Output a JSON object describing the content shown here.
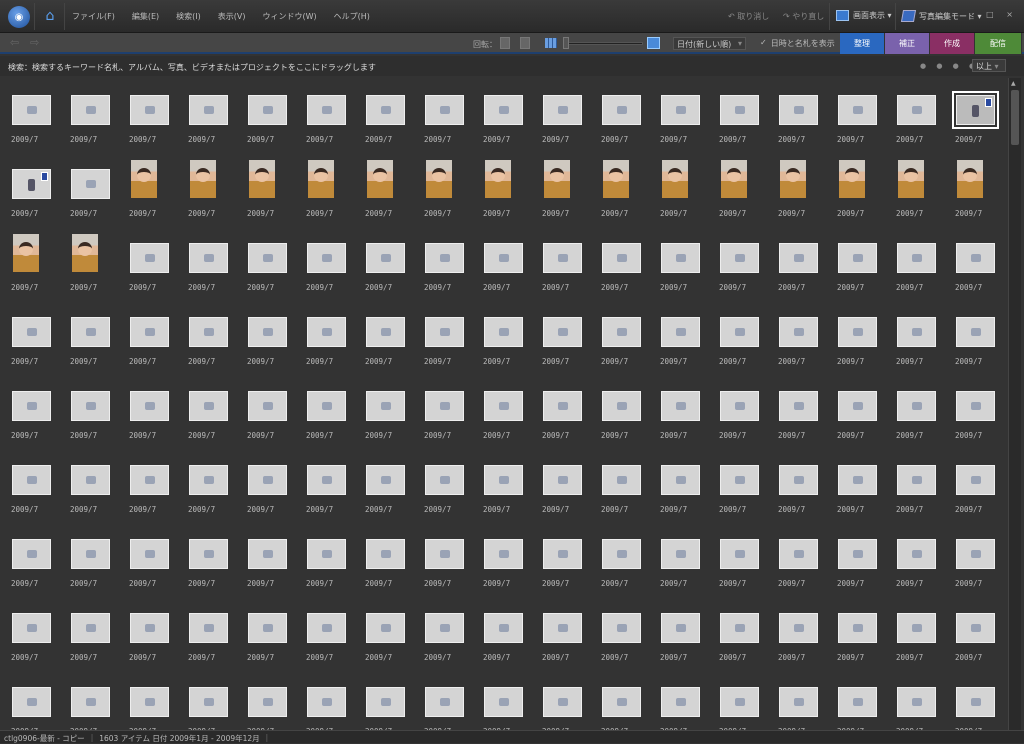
{
  "titlebar": {
    "menu": [
      "ファイル(F)",
      "編集(E)",
      "検索(I)",
      "表示(V)",
      "ウィンドウ(W)",
      "ヘルプ(H)"
    ],
    "undo": "取り消し",
    "redo": "やり直し",
    "display": "画面表示 ▾",
    "edit_mode": "写真編集モード ▾",
    "window_controls": "_ □ ×"
  },
  "toolbar": {
    "rotate_label": "回転：",
    "sort": "日付(新しい順)",
    "show_date_tags": "日時と名札を表示",
    "checkbox_checked": true,
    "tabs": [
      {
        "label": "整理",
        "color": "#2a68c0"
      },
      {
        "label": "補正",
        "color": "#7a62ac"
      },
      {
        "label": "作成",
        "color": "#8a2f64"
      },
      {
        "label": "配信",
        "color": "#4e8a38"
      }
    ]
  },
  "search": {
    "text": "検索：検索するキーワード名札、アルバム、写真、ビデオまたはプロジェクトをここにドラッグします",
    "stars": "● ● ● ● ●",
    "rating_filter": "以上"
  },
  "thumbnails": {
    "date_label": "2009/7",
    "rows": [
      [
        "placeholder",
        "placeholder",
        "placeholder",
        "placeholder",
        "placeholder",
        "placeholder",
        "placeholder",
        "placeholder",
        "placeholder",
        "placeholder",
        "placeholder",
        "placeholder",
        "placeholder",
        "placeholder",
        "placeholder",
        "placeholder",
        "video-selected"
      ],
      [
        "video",
        "placeholder",
        "photo",
        "photo",
        "photo",
        "photo",
        "photo",
        "photo",
        "photo",
        "photo",
        "photo",
        "photo",
        "photo",
        "photo",
        "photo",
        "photo",
        "photo"
      ],
      [
        "photo",
        "photo",
        "placeholder",
        "placeholder",
        "placeholder",
        "placeholder",
        "placeholder",
        "placeholder",
        "placeholder",
        "placeholder",
        "placeholder",
        "placeholder",
        "placeholder",
        "placeholder",
        "placeholder",
        "placeholder",
        "placeholder"
      ],
      [
        "placeholder",
        "placeholder",
        "placeholder",
        "placeholder",
        "placeholder",
        "placeholder",
        "placeholder",
        "placeholder",
        "placeholder",
        "placeholder",
        "placeholder",
        "placeholder",
        "placeholder",
        "placeholder",
        "placeholder",
        "placeholder",
        "placeholder"
      ],
      [
        "placeholder",
        "placeholder",
        "placeholder",
        "placeholder",
        "placeholder",
        "placeholder",
        "placeholder",
        "placeholder",
        "placeholder",
        "placeholder",
        "placeholder",
        "placeholder",
        "placeholder",
        "placeholder",
        "placeholder",
        "placeholder",
        "placeholder"
      ],
      [
        "placeholder",
        "placeholder",
        "placeholder",
        "placeholder",
        "placeholder",
        "placeholder",
        "placeholder",
        "placeholder",
        "placeholder",
        "placeholder",
        "placeholder",
        "placeholder",
        "placeholder",
        "placeholder",
        "placeholder",
        "placeholder",
        "placeholder"
      ],
      [
        "placeholder",
        "placeholder",
        "placeholder",
        "placeholder",
        "placeholder",
        "placeholder",
        "placeholder",
        "placeholder",
        "placeholder",
        "placeholder",
        "placeholder",
        "placeholder",
        "placeholder",
        "placeholder",
        "placeholder",
        "placeholder",
        "placeholder"
      ],
      [
        "placeholder",
        "placeholder",
        "placeholder",
        "placeholder",
        "placeholder",
        "placeholder",
        "placeholder",
        "placeholder",
        "placeholder",
        "placeholder",
        "placeholder",
        "placeholder",
        "placeholder",
        "placeholder",
        "placeholder",
        "placeholder",
        "placeholder"
      ],
      [
        "placeholder",
        "placeholder",
        "placeholder",
        "placeholder",
        "placeholder",
        "placeholder",
        "placeholder",
        "placeholder",
        "placeholder",
        "placeholder",
        "placeholder",
        "placeholder",
        "placeholder",
        "placeholder",
        "placeholder",
        "placeholder",
        "placeholder"
      ]
    ]
  },
  "status": {
    "catalog": "ctlg0906-最新 - コピー",
    "count_range": "1603 アイテム 日付 2009年1月 - 2009年12月"
  }
}
